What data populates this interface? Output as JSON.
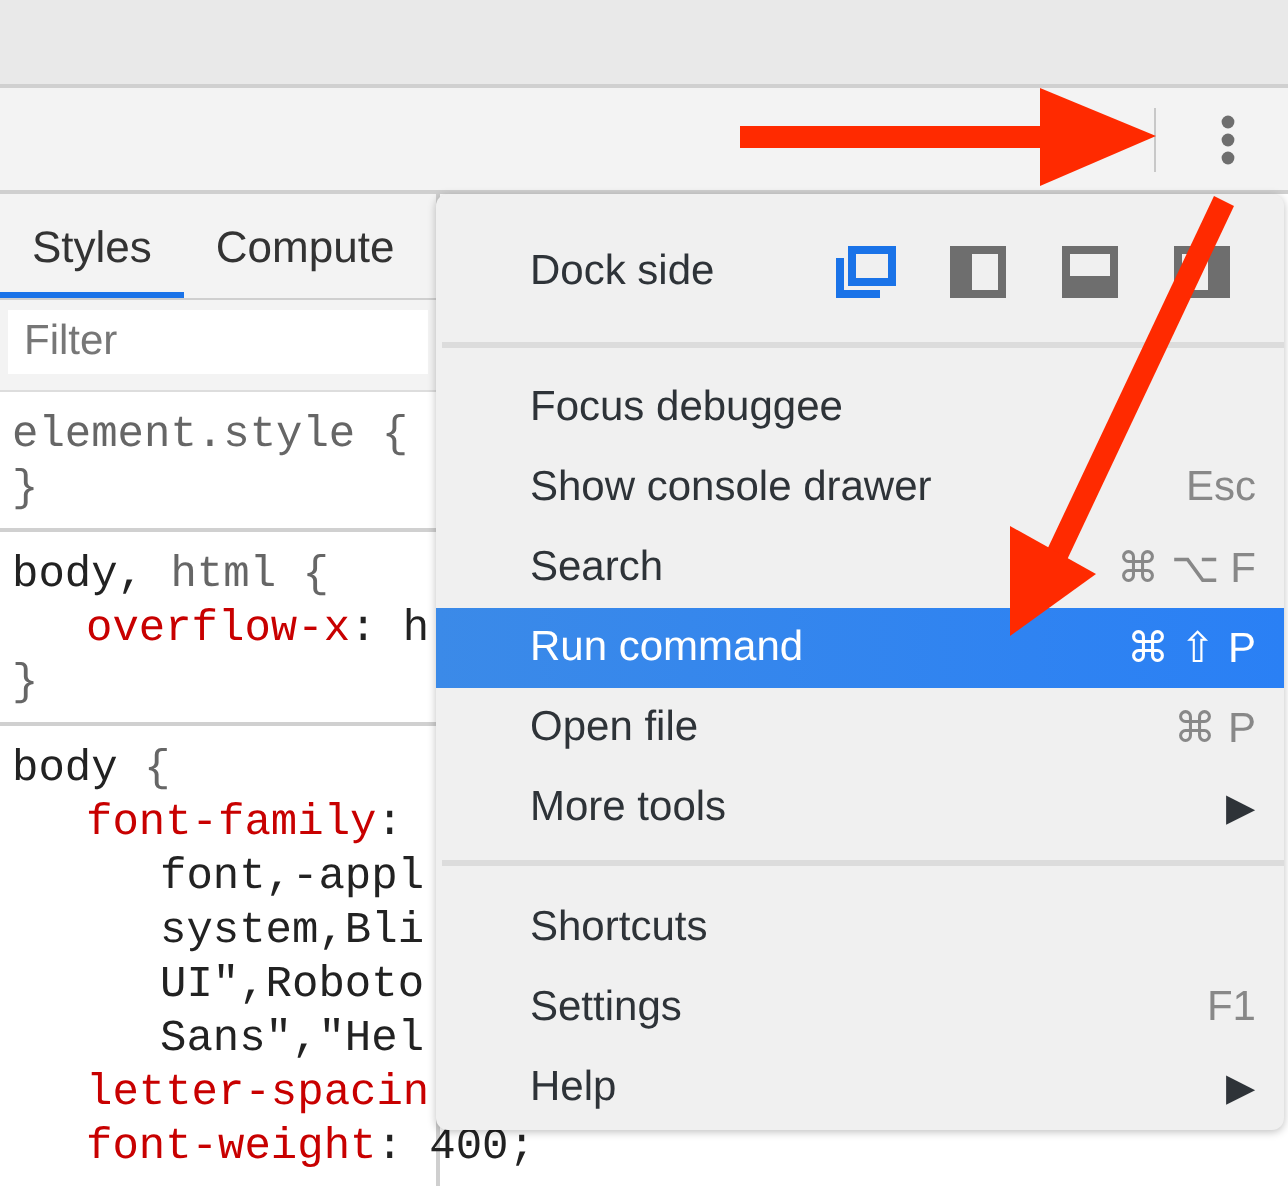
{
  "tabs": [
    {
      "label": "Styles",
      "selected": true
    },
    {
      "label": "Compute",
      "selected": false
    }
  ],
  "filter": {
    "placeholder": "Filter"
  },
  "rules": [
    {
      "lines": [
        {
          "kind": "selector",
          "segments": [
            {
              "kind": "muted",
              "text": "element.style {"
            }
          ]
        },
        {
          "kind": "close",
          "segments": [
            {
              "kind": "muted",
              "text": "}"
            }
          ]
        }
      ]
    },
    {
      "lines": [
        {
          "kind": "selector",
          "segments": [
            {
              "kind": "plain",
              "text": "body, "
            },
            {
              "kind": "muted",
              "text": "html {"
            }
          ]
        },
        {
          "kind": "declaration",
          "segments": [
            {
              "kind": "property",
              "text": "overflow-x"
            },
            {
              "kind": "plain",
              "text": ": h"
            }
          ]
        },
        {
          "kind": "close",
          "segments": [
            {
              "kind": "muted",
              "text": "}"
            }
          ]
        }
      ]
    },
    {
      "lines": [
        {
          "kind": "selector",
          "segments": [
            {
              "kind": "plain",
              "text": "body "
            },
            {
              "kind": "muted",
              "text": "{"
            }
          ]
        },
        {
          "kind": "declaration",
          "segments": [
            {
              "kind": "property",
              "text": "font-family"
            },
            {
              "kind": "plain",
              "text": ":"
            }
          ]
        },
        {
          "kind": "continuation",
          "segments": [
            {
              "kind": "plain",
              "text": "font,-appl"
            }
          ]
        },
        {
          "kind": "continuation",
          "segments": [
            {
              "kind": "plain",
              "text": "system,Bli"
            }
          ]
        },
        {
          "kind": "continuation",
          "segments": [
            {
              "kind": "plain",
              "text": "UI\",Roboto"
            }
          ]
        },
        {
          "kind": "continuation",
          "segments": [
            {
              "kind": "plain",
              "text": "Sans\",\"Hel"
            }
          ]
        },
        {
          "kind": "declaration",
          "segments": [
            {
              "kind": "property",
              "text": "letter-spacin"
            }
          ]
        },
        {
          "kind": "declaration",
          "segments": [
            {
              "kind": "property",
              "text": "font-weight"
            },
            {
              "kind": "plain",
              "text": ": 400;"
            }
          ]
        }
      ]
    }
  ],
  "menu": {
    "sections": [
      {
        "kind": "dock",
        "label": "Dock side",
        "options": [
          {
            "kind": "undocked",
            "selected": true
          },
          {
            "kind": "left",
            "selected": false
          },
          {
            "kind": "bottom",
            "selected": false
          },
          {
            "kind": "right",
            "selected": false
          }
        ]
      },
      {
        "kind": "items",
        "items": [
          {
            "label": "Focus debuggee",
            "selected": false
          },
          {
            "label": "Show console drawer",
            "shortcut": "Esc",
            "selected": false
          },
          {
            "label": "Search",
            "shortcut": "⌘ ⌥ F",
            "selected": false
          },
          {
            "label": "Run command",
            "shortcut": "⌘ ⇧ P",
            "selected": true
          },
          {
            "label": "Open file",
            "shortcut": "⌘ P",
            "selected": false
          },
          {
            "label": "More tools",
            "submenu": "▶",
            "selected": false
          }
        ]
      },
      {
        "kind": "items",
        "items": [
          {
            "label": "Shortcuts",
            "selected": false
          },
          {
            "label": "Settings",
            "shortcut": "F1",
            "selected": false
          },
          {
            "label": "Help",
            "submenu": "▶",
            "selected": false
          }
        ]
      }
    ]
  }
}
